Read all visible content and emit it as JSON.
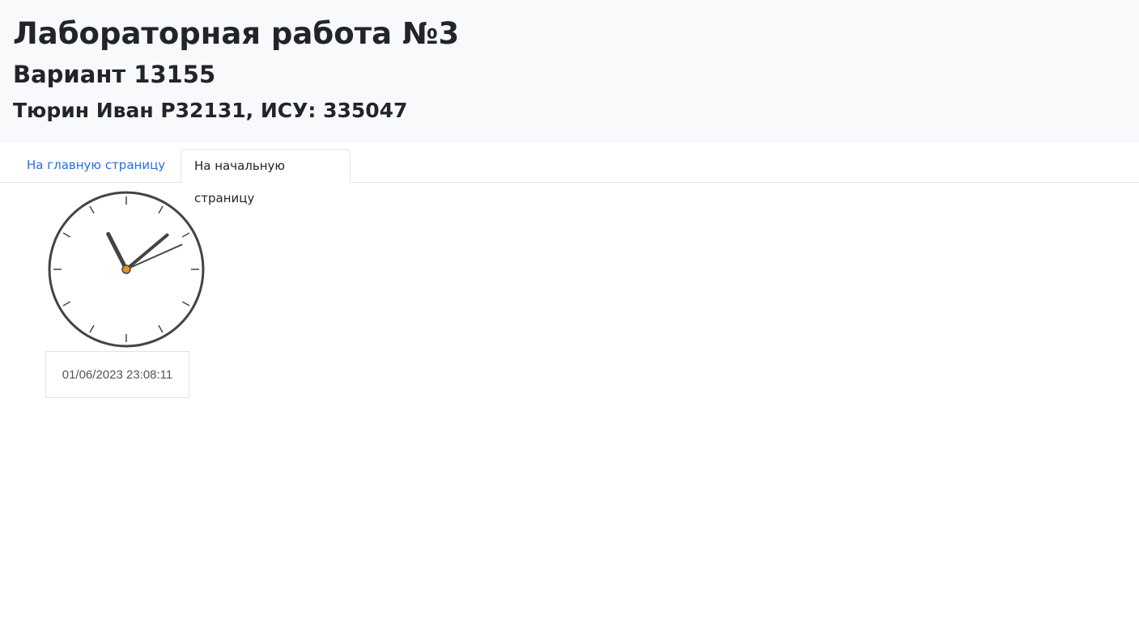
{
  "header": {
    "title": "Лабораторная работа №3",
    "variant": "Вариант 13155",
    "author": "Тюрин Иван Р32131, ИСУ: 335047"
  },
  "tabs": [
    {
      "label": "На главную страницу",
      "active": false
    },
    {
      "label": "На начальную страницу",
      "active": true
    }
  ],
  "clock": {
    "hours": 23,
    "minutes": 8,
    "seconds": 11,
    "datetime": "01/06/2023 23:08:11",
    "colors": {
      "face_stroke": "#444444",
      "hand": "#444444",
      "center_dot": "#f0901a"
    }
  }
}
